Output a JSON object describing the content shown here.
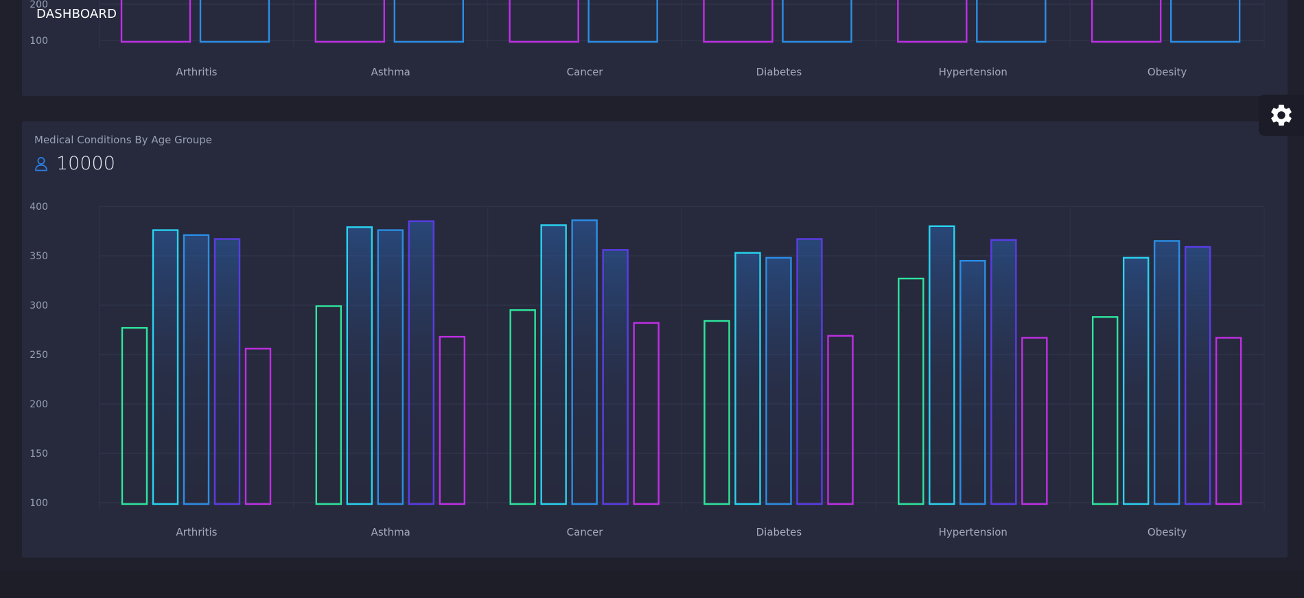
{
  "header": {
    "title": "DASHBOARD"
  },
  "top_card": {
    "ytick_labels": [
      "200",
      "100"
    ],
    "categories": [
      "Arthritis",
      "Asthma",
      "Cancer",
      "Diabetes",
      "Hypertension",
      "Obesity"
    ]
  },
  "bottom_card": {
    "title": "Medical Conditions By Age Groupe",
    "total_icon": "user-icon",
    "total_value": "10000"
  },
  "settings": {
    "icon": "gear-icon"
  },
  "colors": {
    "series": [
      "#2ee59d",
      "#29d3f0",
      "#2b8ee6",
      "#5b3ce6",
      "#c12ee6"
    ],
    "card": "#272a3d",
    "background": "#20202d"
  },
  "chart_data": {
    "type": "bar",
    "categories": [
      "Arthritis",
      "Asthma",
      "Cancer",
      "Diabetes",
      "Hypertension",
      "Obesity"
    ],
    "series": [
      {
        "values": [
          277,
          299,
          295,
          284,
          327,
          288
        ]
      },
      {
        "values": [
          376,
          379,
          381,
          353,
          380,
          348
        ]
      },
      {
        "values": [
          371,
          376,
          386,
          348,
          345,
          365
        ]
      },
      {
        "values": [
          367,
          385,
          356,
          367,
          366,
          359
        ]
      },
      {
        "values": [
          256,
          268,
          282,
          269,
          267,
          267
        ]
      }
    ],
    "yticks": [
      100,
      150,
      200,
      250,
      300,
      350,
      400
    ],
    "ylim": [
      100,
      400
    ],
    "grid": true,
    "legend": "none"
  }
}
